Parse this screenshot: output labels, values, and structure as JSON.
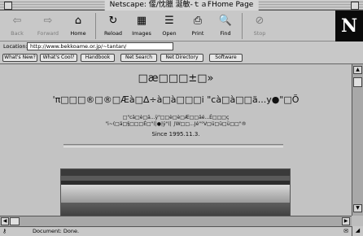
{
  "window": {
    "title": "Netscape: 偃/忱臘 涎敏-ｔａFHome Page"
  },
  "toolbar": {
    "buttons": [
      {
        "label": "Back",
        "icon": "back-arrow-icon",
        "glyph": "⇦",
        "enabled": false
      },
      {
        "label": "Forward",
        "icon": "forward-arrow-icon",
        "glyph": "⇨",
        "enabled": false
      },
      {
        "label": "Home",
        "icon": "home-icon",
        "glyph": "⌂",
        "enabled": true
      },
      {
        "label": "Reload",
        "icon": "reload-icon",
        "glyph": "↻",
        "enabled": true
      },
      {
        "label": "Images",
        "icon": "images-icon",
        "glyph": "▦",
        "enabled": true
      },
      {
        "label": "Open",
        "icon": "open-icon",
        "glyph": "☰",
        "enabled": true
      },
      {
        "label": "Print",
        "icon": "print-icon",
        "glyph": "⎙",
        "enabled": true
      },
      {
        "label": "Find",
        "icon": "find-icon",
        "glyph": "🔍",
        "enabled": true
      },
      {
        "label": "Stop",
        "icon": "stop-icon",
        "glyph": "⊘",
        "enabled": false
      }
    ],
    "logo": "N"
  },
  "location": {
    "label": "Location:",
    "url": "http://www.bekkoame.or.jp/~tantan/"
  },
  "directory_buttons": [
    "What's New?",
    "What's Cool?",
    "Handbook",
    "Net Search",
    "Net Directory",
    "Software"
  ],
  "content": {
    "heading1": "□æ□□□±□»",
    "heading2": "'π□□□®□®□Æà□∆÷à□à□□□i \"cà□à□□ä...y●\"□Õ",
    "line1": "□\"cä□è□ä...ÿ\"□□è□è□Æ□□äé...É□□□ç",
    "line2": "\"i~(□ä□§□□□É□\"(|●|ÿ\"(| ∫W□□...Jé\"°V□ü□ü□ü□□\"®",
    "since": "Since 1995.11.3."
  },
  "status": {
    "icon": "netscape-key-icon",
    "text": "Document: Done."
  }
}
